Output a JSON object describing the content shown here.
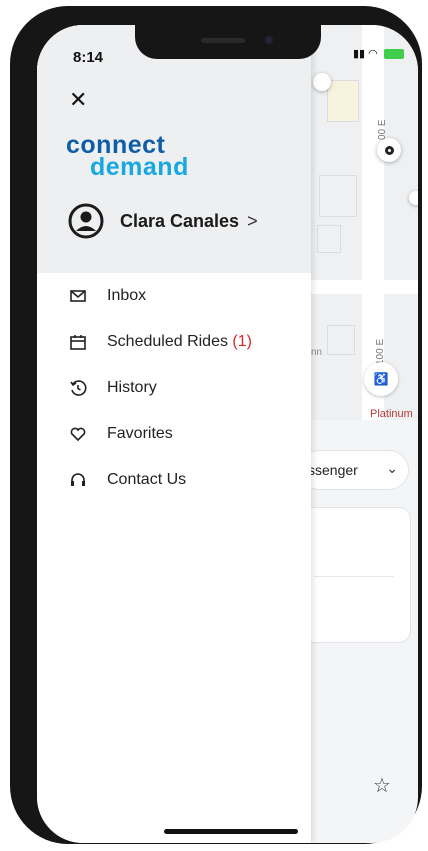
{
  "status_bar": {
    "time": "8:14"
  },
  "drawer": {
    "close_icon": "close-icon",
    "logo": {
      "line1": "connect",
      "line2": "demand"
    },
    "profile": {
      "name": "Clara Canales",
      "chevron": ">"
    },
    "menu": [
      {
        "label": "Inbox",
        "icon": "mail-icon"
      },
      {
        "label": "Scheduled Rides",
        "count": "(1)",
        "icon": "calendar-icon"
      },
      {
        "label": "History",
        "icon": "history-icon"
      },
      {
        "label": "Favorites",
        "icon": "heart-icon"
      },
      {
        "label": "Contact Us",
        "icon": "headset-icon"
      }
    ]
  },
  "background": {
    "map": {
      "street_1": "00 E",
      "street_2": "100 E",
      "place_label": "Platinum",
      "partial_label": "nn"
    },
    "passenger_selector": "ssenger",
    "favorite_icon": "star-icon"
  },
  "colors": {
    "logo_dark": "#0e5ea7",
    "logo_light": "#17a8e0",
    "count": "#d12a2a"
  }
}
